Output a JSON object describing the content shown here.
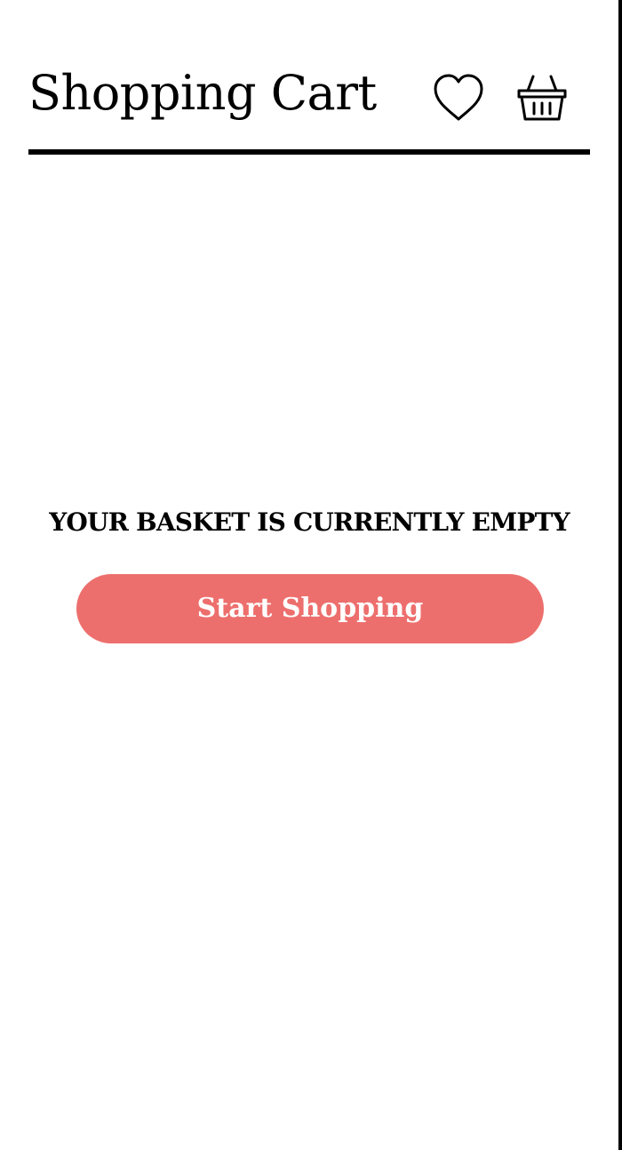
{
  "header": {
    "title": "Shopping Cart",
    "icons": {
      "wishlist": "heart-icon",
      "basket": "basket-icon"
    }
  },
  "main": {
    "empty_message": "YOUR BASKET IS CURRENTLY EMPTY",
    "cta_label": "Start Shopping"
  },
  "colors": {
    "accent": "#ed6f6d",
    "text": "#000000",
    "background": "#ffffff"
  }
}
